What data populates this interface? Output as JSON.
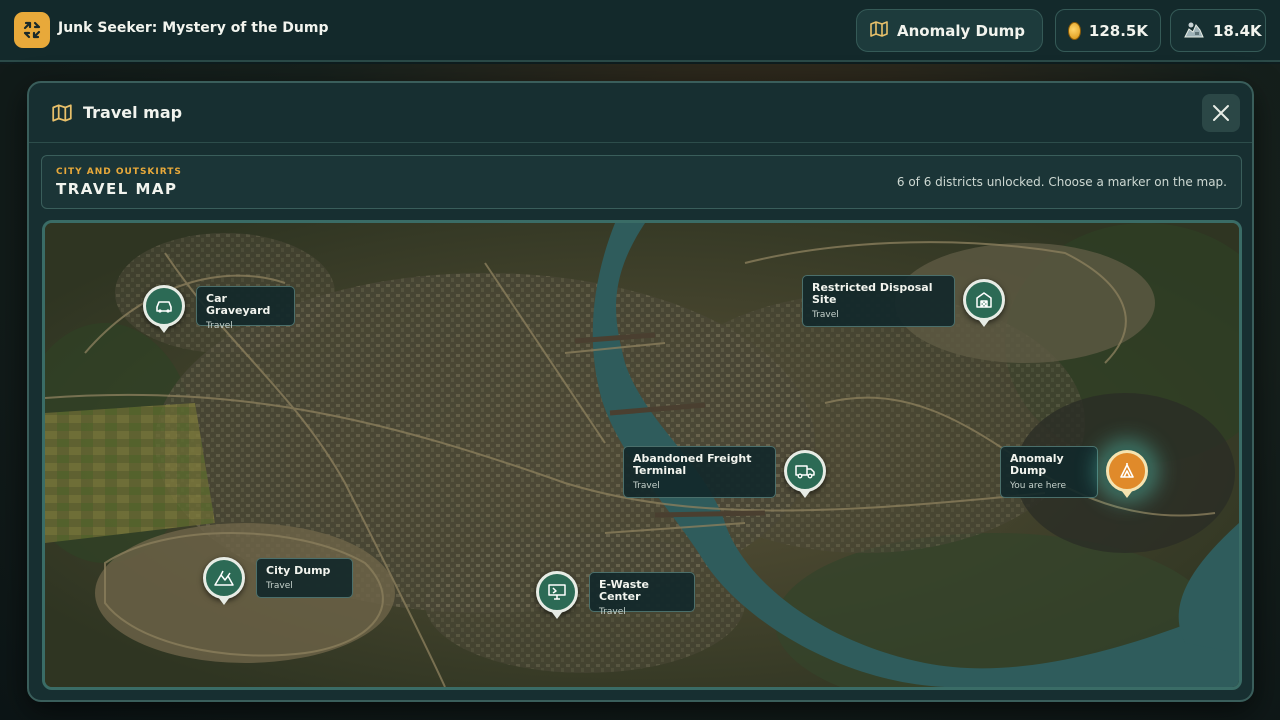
{
  "app": {
    "title": "Junk Seeker: Mystery of the Dump",
    "icon": "recycle-arrows-icon"
  },
  "header": {
    "location": {
      "label": "Anomaly Dump",
      "icon": "map-icon"
    },
    "coins": {
      "value": "128.5K",
      "icon": "coin-icon"
    },
    "scrap": {
      "value": "18.4K",
      "icon": "scrap-pile-icon"
    }
  },
  "modal": {
    "title": "Travel map",
    "eyebrow": "CITY AND OUTSKIRTS",
    "heading": "TRAVEL MAP",
    "status": "6 of 6 districts unlocked. Choose a marker on the map.",
    "close_icon": "close-icon"
  },
  "locations": [
    {
      "name": "Car Graveyard",
      "action": "Travel",
      "icon": "car-icon",
      "current": false
    },
    {
      "name": "Restricted Disposal Site",
      "action": "Travel",
      "icon": "warehouse-icon",
      "current": false
    },
    {
      "name": "Abandoned Freight Terminal",
      "action": "Travel",
      "icon": "truck-icon",
      "current": false
    },
    {
      "name": "Anomaly Dump",
      "action": "You are here",
      "icon": "anomaly-icon",
      "current": true
    },
    {
      "name": "City Dump",
      "action": "Travel",
      "icon": "trash-heap-icon",
      "current": false
    },
    {
      "name": "E-Waste Center",
      "action": "Travel",
      "icon": "monitor-icon",
      "current": false
    }
  ],
  "colors": {
    "accent": "#e8a93a",
    "marker": "#2c6a55",
    "marker_active": "#e08a2a",
    "panel": "#172f31"
  }
}
